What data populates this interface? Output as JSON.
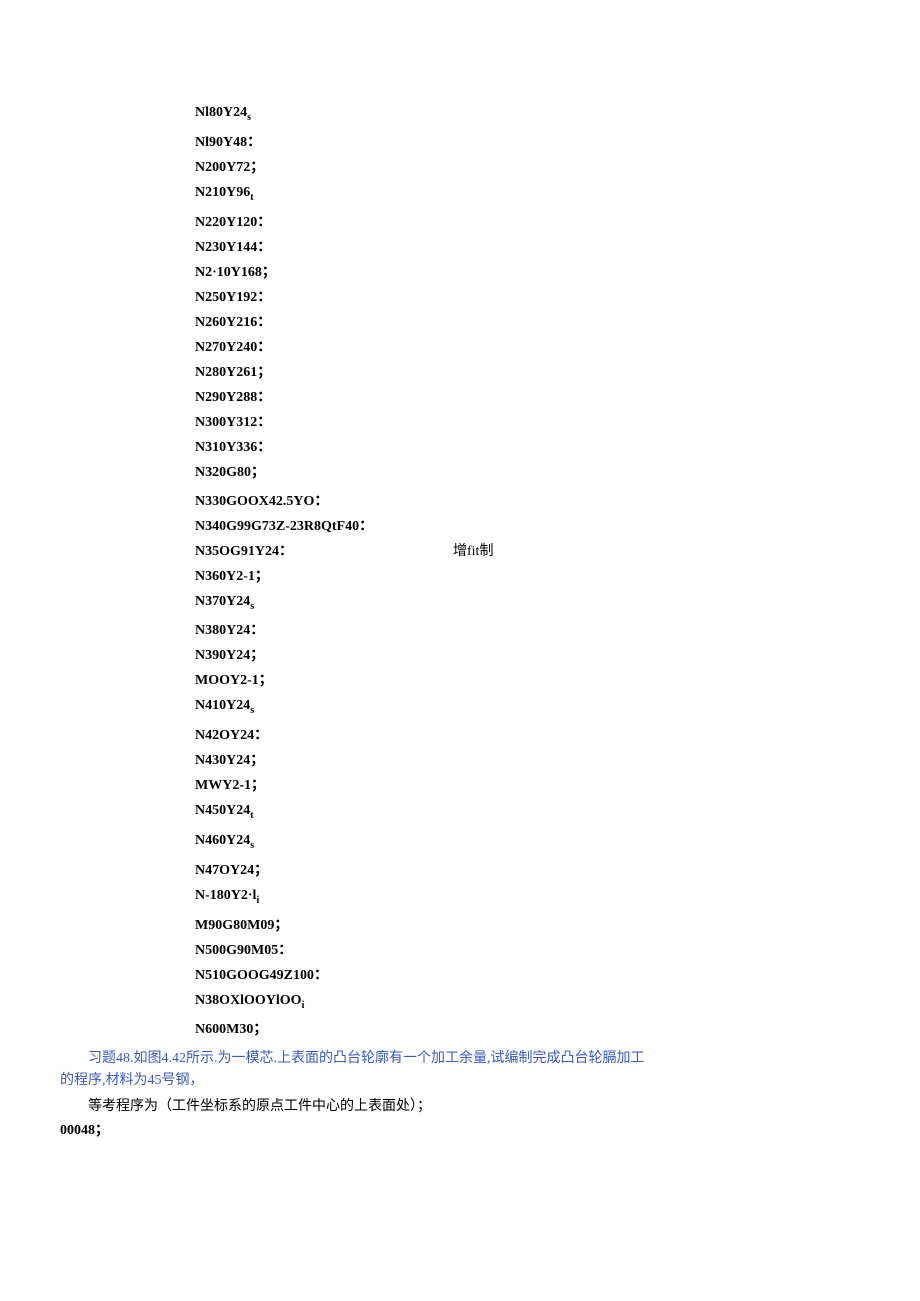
{
  "lines": [
    {
      "t": "Nl80Y24",
      "s": "s"
    },
    {
      "t": "Nl90Y48："
    },
    {
      "t": "N200Y72；"
    },
    {
      "t": "N210Y96",
      "s": "t"
    },
    {
      "t": "N220Y120："
    },
    {
      "t": "N230Y144："
    },
    {
      "t": "N2·10Y168；"
    },
    {
      "t": "N250Y192："
    },
    {
      "t": "N260Y216："
    },
    {
      "t": "N270Y240："
    },
    {
      "t": "N280Y261；"
    },
    {
      "t": "N290Y288："
    },
    {
      "t": "N300Y312："
    },
    {
      "t": "N310Y336："
    },
    {
      "t": "N320G80；"
    },
    {
      "gap": true
    },
    {
      "t": "N330GOOX42.5YO："
    },
    {
      "t": "N340G99G73Z-23R8QtF40："
    },
    {
      "t": "N35OG91Y24：",
      "c": "增fit制"
    },
    {
      "t": "N360Y2-1；"
    },
    {
      "t": "N370Y24",
      "s": "s"
    },
    {
      "t": "N380Y24："
    },
    {
      "t": "N390Y24；"
    },
    {
      "t": "MOOY2-1；"
    },
    {
      "t": "N410Y24",
      "s": "s"
    },
    {
      "t": "N42OY24："
    },
    {
      "t": "N430Y24；"
    },
    {
      "t": "MWY2-1；"
    },
    {
      "t": "N450Y24",
      "s": "t"
    },
    {
      "t": "N460Y24",
      "s": "s"
    },
    {
      "t": "N47OY24；"
    },
    {
      "t": "N-180Y2·l",
      "s": "i"
    },
    {
      "t": "M90G80M09；"
    },
    {
      "t": "N500G90M05："
    },
    {
      "t": "N510GOOG49Z100："
    },
    {
      "t": "N38OXlOOYlOO",
      "s": "i"
    },
    {
      "t": "N600M30；"
    }
  ],
  "para1a": "习题48.如图4.42所示.为一模芯.上表面的凸台轮廓有一个加工余量,试编制完成凸台轮膈加工",
  "para1b": "的程序,材料为45号钢，",
  "para2": "等考程序为（工件坐标系的原点工件中心的上表面处）；",
  "para3": "00048；"
}
